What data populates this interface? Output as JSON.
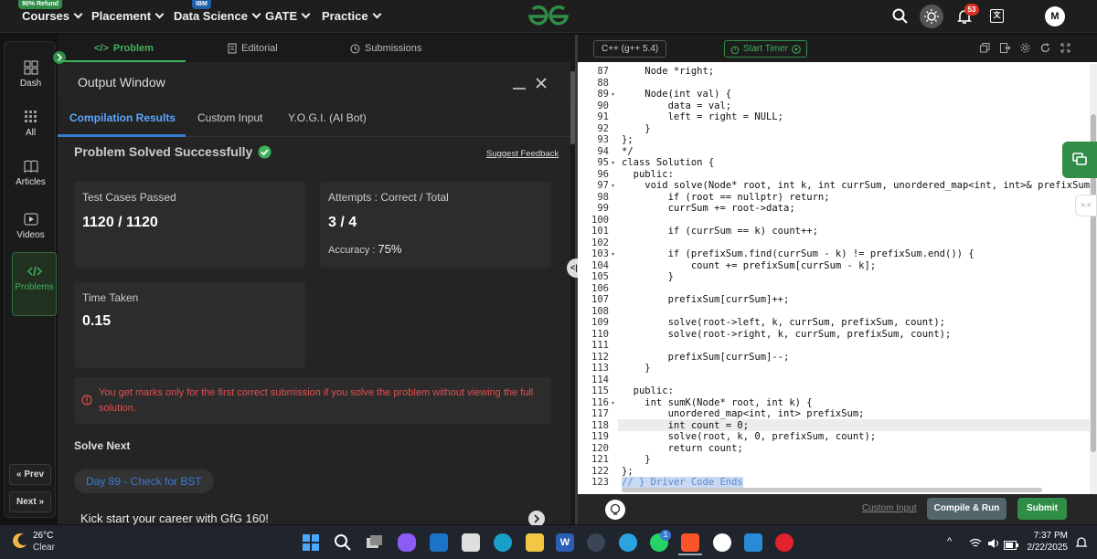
{
  "nav": {
    "courses": "Courses",
    "courses_tag": "90% Refund",
    "placement": "Placement",
    "data_science": "Data Science",
    "data_science_tag": "IBM",
    "gate": "GATE",
    "practice": "Practice",
    "notification_count": "53",
    "avatar_initial": "M"
  },
  "sidebar": {
    "items": [
      {
        "label": "Dash",
        "icon": "dashboard-icon"
      },
      {
        "label": "All",
        "icon": "grid-icon"
      },
      {
        "label": "Articles",
        "icon": "book-icon"
      },
      {
        "label": "Videos",
        "icon": "video-icon"
      },
      {
        "label": "Problems",
        "icon": "code-icon"
      }
    ],
    "prev_label": "Prev",
    "next_label": "Next"
  },
  "problem_tabs": {
    "problem": "Problem",
    "editorial": "Editorial",
    "submissions": "Submissions"
  },
  "output_window": {
    "title": "Output Window",
    "tabs": [
      "Compilation Results",
      "Custom Input",
      "Y.O.G.I. (AI Bot)"
    ],
    "status": "Problem Solved Successfully",
    "suggest_feedback": "Suggest Feedback",
    "test_cases_label": "Test Cases Passed",
    "test_cases_value": "1120 / 1120",
    "attempts_label": "Attempts : Correct / Total",
    "attempts_value": "3 / 4",
    "accuracy_label": "Accuracy :",
    "accuracy_value": "75%",
    "time_label": "Time Taken",
    "time_value": "0.15",
    "notice": "You get marks only for the first correct submission if you solve the problem without viewing the full solution.",
    "solve_next_label": "Solve Next",
    "next_problem": "Day 89 - Check for BST",
    "kickstart": "Kick start your career with GfG 160!"
  },
  "editor": {
    "language": "C++ (g++ 5.4)",
    "start_timer": "Start Timer",
    "custom_input": "Custom Input",
    "compile_run": "Compile & Run",
    "submit": "Submit",
    "lines": [
      {
        "n": "87",
        "code": "    Node *right;"
      },
      {
        "n": "88",
        "code": ""
      },
      {
        "n": "89",
        "code": "    Node(int val) {"
      },
      {
        "n": "90",
        "code": "        data = val;"
      },
      {
        "n": "91",
        "code": "        left = right = NULL;"
      },
      {
        "n": "92",
        "code": "    }"
      },
      {
        "n": "93",
        "code": "};"
      },
      {
        "n": "94",
        "code": "*/"
      },
      {
        "n": "95",
        "code": "class Solution {"
      },
      {
        "n": "96",
        "code": "  public:"
      },
      {
        "n": "97",
        "code": "    void solve(Node* root, int k, int currSum, unordered_map<int, int>& prefixSum, int"
      },
      {
        "n": "98",
        "code": "        if (root == nullptr) return;"
      },
      {
        "n": "99",
        "code": "        currSum += root->data;"
      },
      {
        "n": "100",
        "code": ""
      },
      {
        "n": "101",
        "code": "        if (currSum == k) count++;"
      },
      {
        "n": "102",
        "code": ""
      },
      {
        "n": "103",
        "code": "        if (prefixSum.find(currSum - k) != prefixSum.end()) {"
      },
      {
        "n": "104",
        "code": "            count += prefixSum[currSum - k];"
      },
      {
        "n": "105",
        "code": "        }"
      },
      {
        "n": "106",
        "code": ""
      },
      {
        "n": "107",
        "code": "        prefixSum[currSum]++;"
      },
      {
        "n": "108",
        "code": ""
      },
      {
        "n": "109",
        "code": "        solve(root->left, k, currSum, prefixSum, count);"
      },
      {
        "n": "110",
        "code": "        solve(root->right, k, currSum, prefixSum, count);"
      },
      {
        "n": "111",
        "code": ""
      },
      {
        "n": "112",
        "code": "        prefixSum[currSum]--;"
      },
      {
        "n": "113",
        "code": "    }"
      },
      {
        "n": "114",
        "code": ""
      },
      {
        "n": "115",
        "code": "  public:"
      },
      {
        "n": "116",
        "code": "    int sumK(Node* root, int k) {"
      },
      {
        "n": "117",
        "code": "        unordered_map<int, int> prefixSum;"
      },
      {
        "n": "118",
        "code": "        int count = 0;"
      },
      {
        "n": "119",
        "code": "        solve(root, k, 0, prefixSum, count);"
      },
      {
        "n": "120",
        "code": "        return count;"
      },
      {
        "n": "121",
        "code": "    }"
      },
      {
        "n": "122",
        "code": "};"
      },
      {
        "n": "123",
        "code": "// } Driver Code Ends"
      }
    ]
  },
  "taskbar": {
    "temperature": "26°C",
    "weather": "Clear",
    "time": "7:37 PM",
    "date": "2/22/2025",
    "whatsapp_count": "1"
  },
  "colors": {
    "accent_green": "#2f8d46",
    "success_green": "#3fb25a",
    "notice_red": "#e05050",
    "submit_green": "#2f8d46"
  }
}
